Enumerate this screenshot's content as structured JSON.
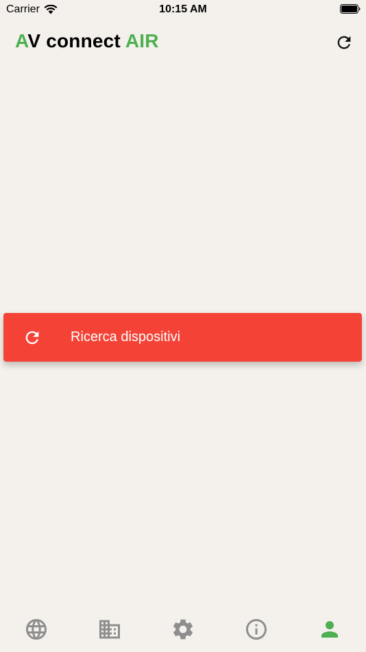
{
  "status_bar": {
    "carrier": "Carrier",
    "time": "10:15 AM"
  },
  "header": {
    "title_parts": [
      "A",
      "V connect ",
      "AIR"
    ],
    "refresh_icon": "refresh-icon"
  },
  "scan_banner": {
    "label": "Ricerca dispositivi",
    "icon": "refresh-icon"
  },
  "tabs": [
    {
      "icon": "globe-icon",
      "active": false
    },
    {
      "icon": "building-icon",
      "active": false
    },
    {
      "icon": "gear-icon",
      "active": false
    },
    {
      "icon": "info-icon",
      "active": false
    },
    {
      "icon": "person-icon",
      "active": true
    }
  ],
  "colors": {
    "accent": "#4caf50",
    "banner": "#f44336",
    "background": "#f4f1ec",
    "tab_inactive": "#8e8e8e",
    "tab_active": "#4caf50"
  }
}
